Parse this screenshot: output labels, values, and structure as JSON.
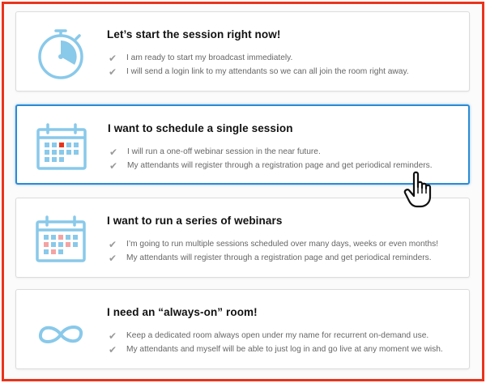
{
  "options": [
    {
      "id": "start-now",
      "icon": "stopwatch-icon",
      "title": "Let’s start the session right now!",
      "items": [
        "I am ready to start my broadcast immediately.",
        "I will send a login link to my attendants so we can all join the room right away."
      ]
    },
    {
      "id": "single-session",
      "icon": "calendar-single-icon",
      "title": "I want to schedule a single session",
      "items": [
        "I will run a one-off webinar session in the near future.",
        "My attendants will register through a registration page and get periodical reminders."
      ],
      "selected": true
    },
    {
      "id": "series",
      "icon": "calendar-series-icon",
      "title": "I want to run a series of webinars",
      "items": [
        "I’m going to run multiple sessions scheduled over many days, weeks or even months!",
        "My attendants will register through a registration page and get periodical reminders."
      ]
    },
    {
      "id": "always-on",
      "icon": "infinity-icon",
      "title": "I need an “always-on” room!",
      "items": [
        "Keep a dedicated room always open under my name for recurrent on-demand use.",
        "My attendants and myself will be able to just log in and go live at any moment we wish."
      ]
    }
  ],
  "colors": {
    "icon_blue": "#89c9ea",
    "highlight_red": "#e8341c",
    "highlight_pink": "#f4a3a3",
    "selected_border": "#2a8bd6"
  },
  "check_glyph": "✔",
  "pointer": "hand-pointer-icon"
}
